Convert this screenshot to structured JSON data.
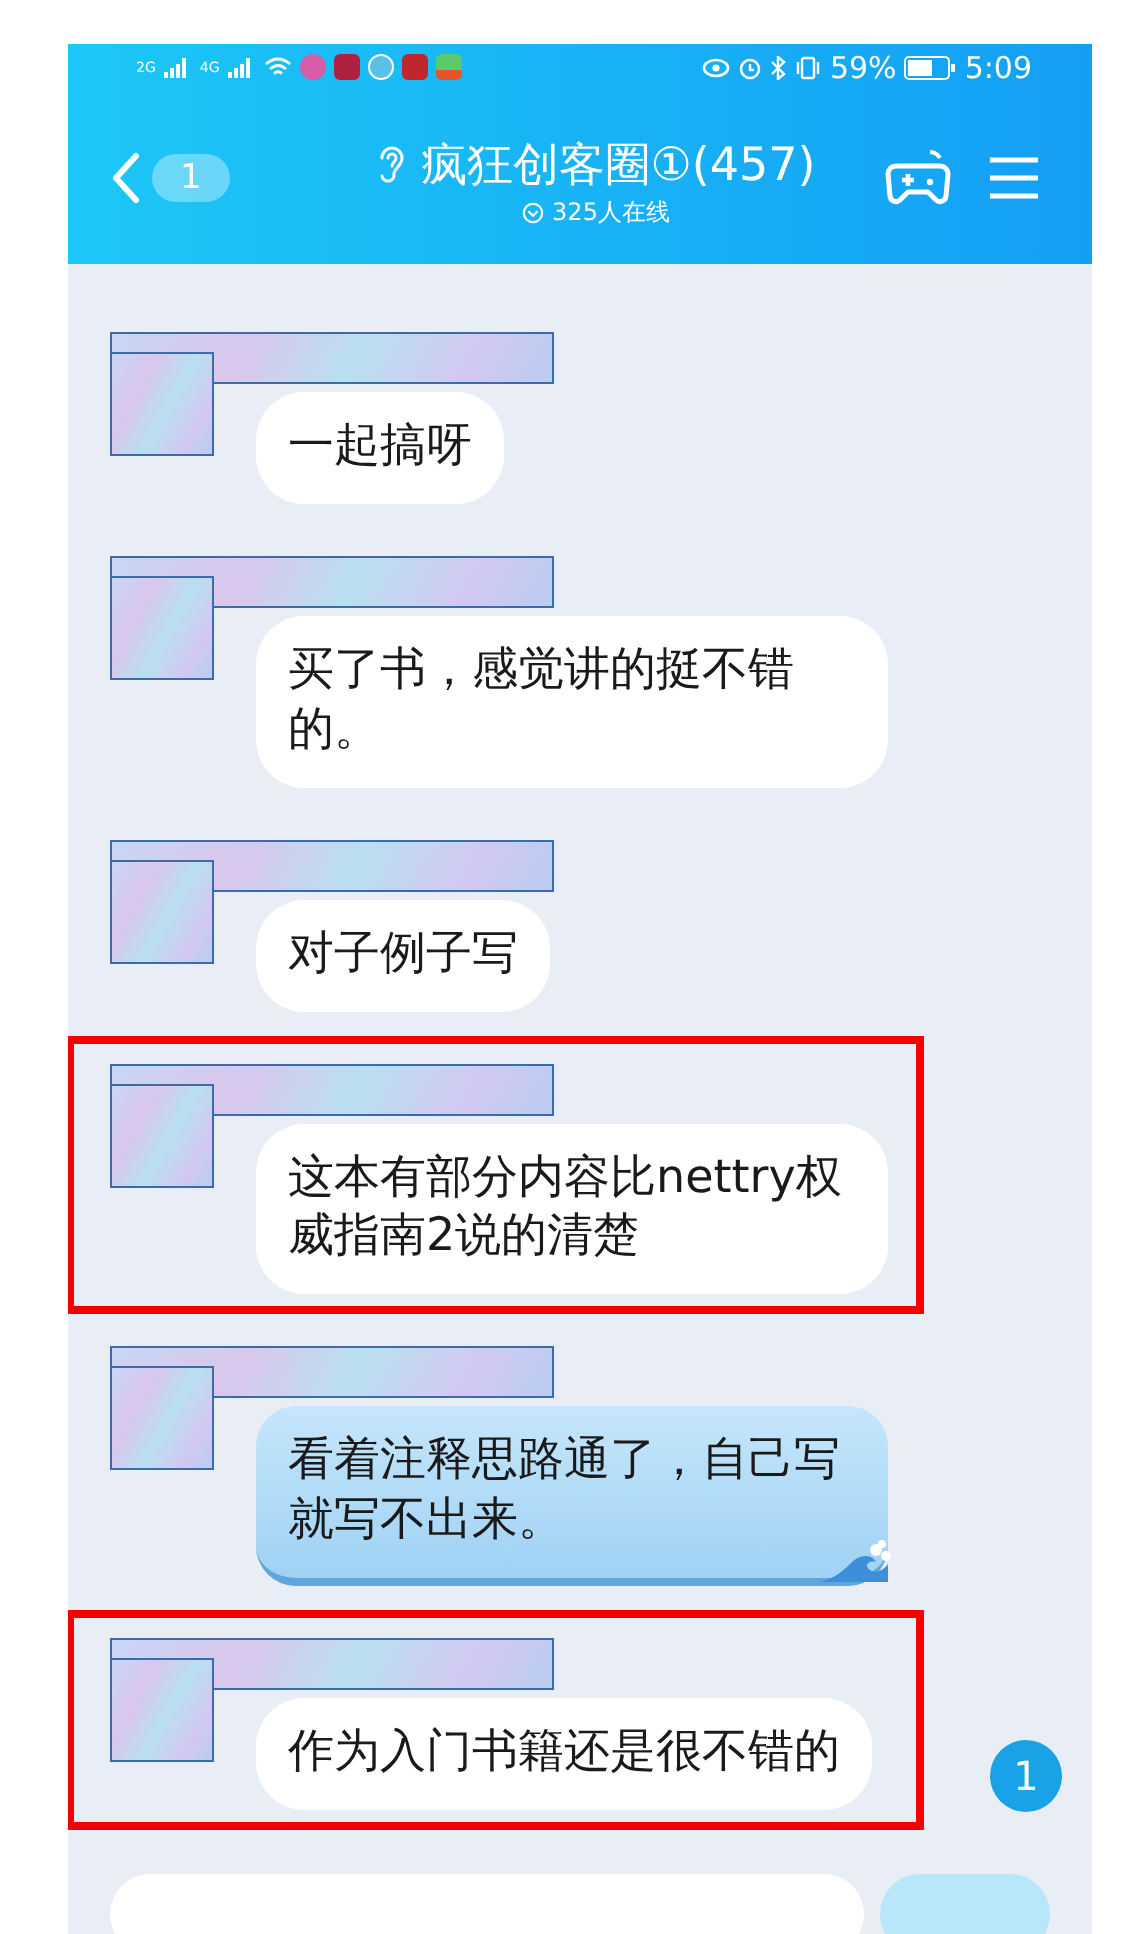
{
  "status_bar": {
    "network_labels": [
      "2G",
      "4G"
    ],
    "battery_percent": "59%",
    "time": "5:09"
  },
  "header": {
    "back_badge": "1",
    "title": "疯狂创客圈①(457)",
    "online": "325人在线"
  },
  "messages": [
    {
      "text": "一起搞呀",
      "kind": "white",
      "highlighted": false
    },
    {
      "text": "买了书，感觉讲的挺不错的。",
      "kind": "white",
      "highlighted": false
    },
    {
      "text": "对子例子写",
      "kind": "white",
      "highlighted": false
    },
    {
      "text": "这本有部分内容比nettry权威指南2说的清楚",
      "kind": "white",
      "highlighted": true
    },
    {
      "text": "看着注释思路通了，自己写就写不出来。",
      "kind": "wave",
      "highlighted": false
    },
    {
      "text": "作为入门书籍还是很不错的",
      "kind": "white",
      "highlighted": true
    }
  ],
  "unread_badge": "1"
}
